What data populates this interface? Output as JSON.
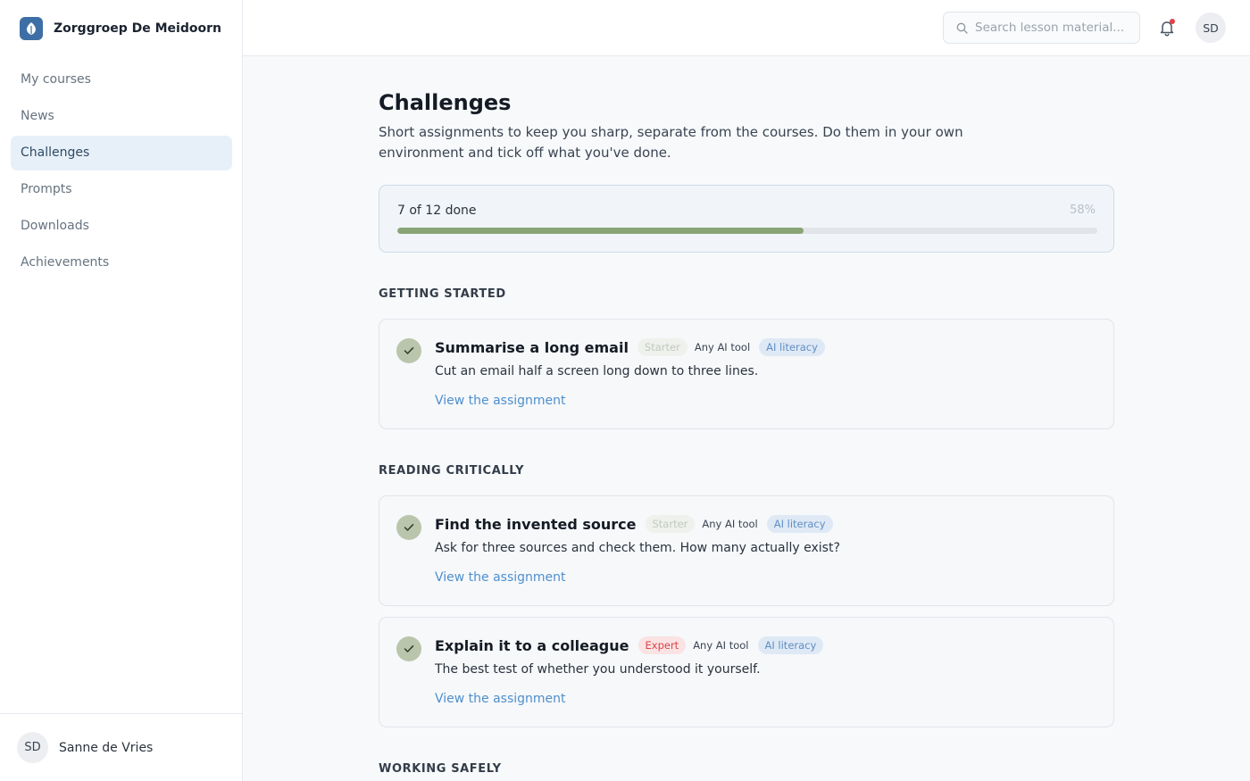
{
  "brand": {
    "name": "Zorggroep De Meidoorn"
  },
  "nav": {
    "items": [
      {
        "label": "My courses",
        "active": false
      },
      {
        "label": "News",
        "active": false
      },
      {
        "label": "Challenges",
        "active": true
      },
      {
        "label": "Prompts",
        "active": false
      },
      {
        "label": "Downloads",
        "active": false
      },
      {
        "label": "Achievements",
        "active": false
      }
    ]
  },
  "user": {
    "initials": "SD",
    "name": "Sanne de Vries"
  },
  "header": {
    "search_placeholder": "Search lesson material...",
    "avatar_initials": "SD",
    "has_notification": true
  },
  "page": {
    "title": "Challenges",
    "description": "Short assignments to keep you sharp, separate from the courses. Do them in your own environment and tick off what you've done."
  },
  "progress": {
    "label": "7 of 12 done",
    "percent_label": "58%",
    "fraction": 0.58
  },
  "sections": [
    {
      "title": "GETTING STARTED",
      "challenges": [
        {
          "title": "Summarise a long email",
          "level": "Starter",
          "tool": "Any AI tool",
          "topic": "AI literacy",
          "description": "Cut an email half a screen long down to three lines.",
          "link": "View the assignment",
          "done": true
        }
      ]
    },
    {
      "title": "READING CRITICALLY",
      "challenges": [
        {
          "title": "Find the invented source",
          "level": "Starter",
          "tool": "Any AI tool",
          "topic": "AI literacy",
          "description": "Ask for three sources and check them. How many actually exist?",
          "link": "View the assignment",
          "done": true
        },
        {
          "title": "Explain it to a colleague",
          "level": "Expert",
          "tool": "Any AI tool",
          "topic": "AI literacy",
          "description": "The best test of whether you understood it yourself.",
          "link": "View the assignment",
          "done": true
        }
      ]
    },
    {
      "title": "WORKING SAFELY",
      "challenges": []
    }
  ],
  "colors": {
    "accent": "#4f8fcd",
    "progress": "#8aa476",
    "done_check": "#b9c6ac",
    "expert": "#d9434b",
    "nav_active_bg": "#e7f0f8"
  }
}
